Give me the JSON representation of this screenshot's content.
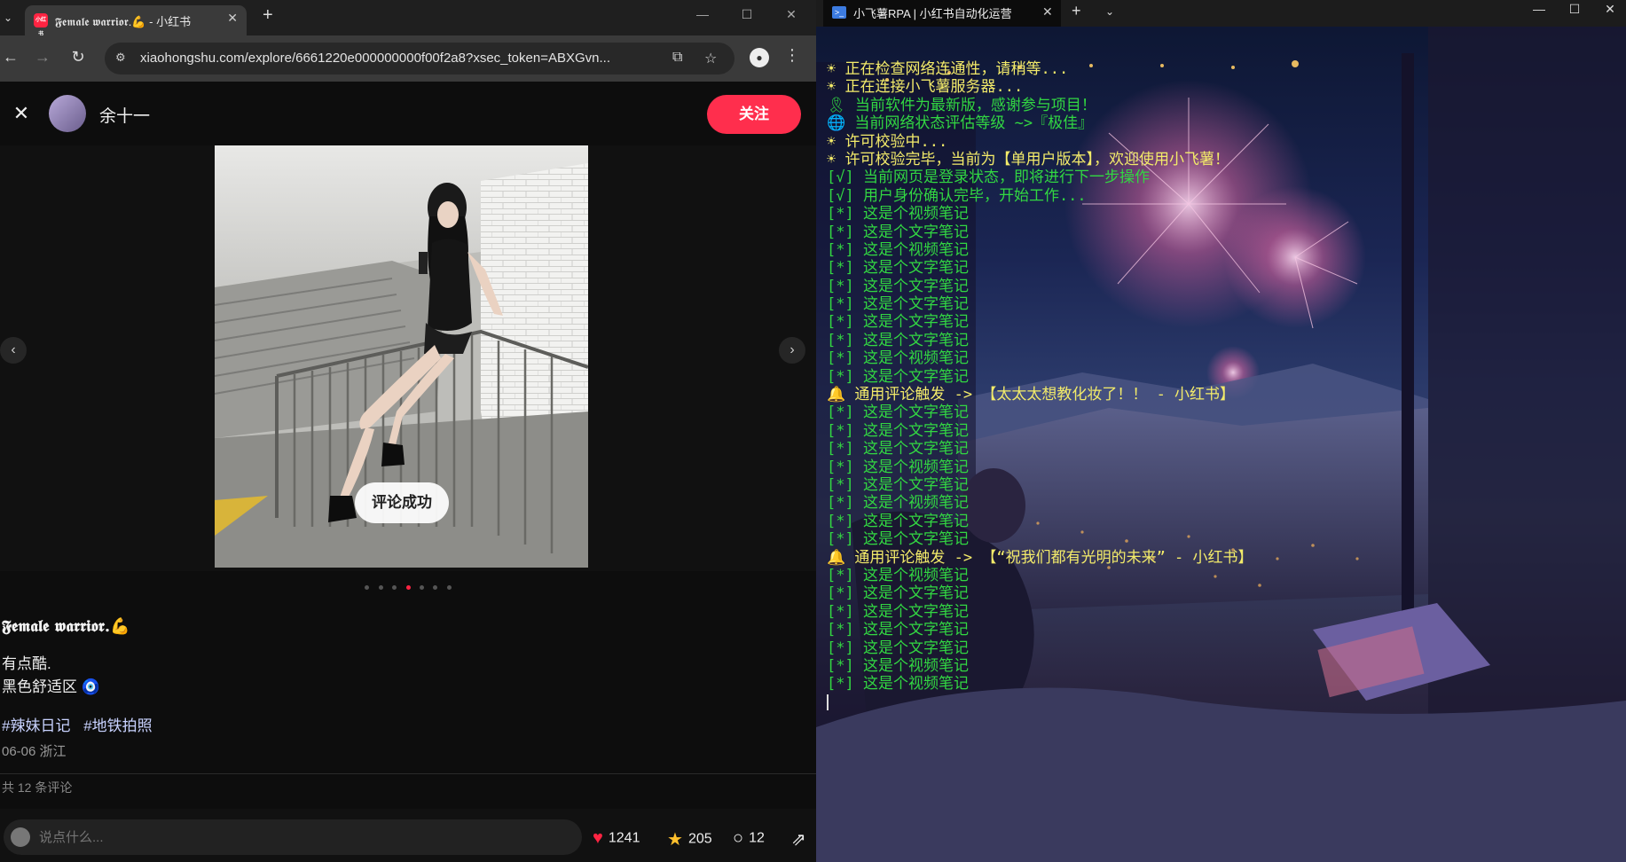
{
  "browser": {
    "tab_title": "𝕱𝖊𝖒𝖆𝖑𝖊 𝖜𝖆𝖗𝖗𝖎𝖔𝖗.💪 - 小红书",
    "url": "xiaohongshu.com/explore/6661220e000000000f00f2a8?xsec_token=ABXGvn...",
    "favicon_text": "小红书"
  },
  "note": {
    "author": "余十一",
    "follow_label": "关注",
    "toast": "评论成功",
    "title": "𝕱𝖊𝖒𝖆𝖑𝖊 𝖜𝖆𝖗𝖗𝖎𝖔𝖗.💪",
    "desc_lines": [
      "有点酷.",
      "黑色舒适区 🧿"
    ],
    "tags": [
      "#辣妹日记",
      "#地铁拍照"
    ],
    "meta": "06-06 浙江",
    "comments_total": "共 12 条评论",
    "comment_placeholder": "说点什么...",
    "likes": "1241",
    "collects": "205",
    "comments": "12",
    "carousel_current": 4,
    "carousel_total": 7
  },
  "terminal": {
    "tab_title": "小飞薯RPA | 小红书自动化运营",
    "lines": [
      {
        "icon": "☀",
        "text": "正在检查网络连通性，请稍等...",
        "color": "yellow"
      },
      {
        "icon": "☀",
        "text": "正在连接小飞薯服务器...",
        "color": "yellow"
      },
      {
        "icon": "🎗",
        "text": "当前软件为最新版，感谢参与项目！",
        "color": "green"
      },
      {
        "icon": "🌐",
        "text": "当前网络状态评估等级 ~>『极佳』",
        "color": "green"
      },
      {
        "icon": "☀",
        "text": "许可校验中...",
        "color": "yellow"
      },
      {
        "icon": "☀",
        "text": "许可校验完毕，当前为【单用户版本】，欢迎使用小飞薯！",
        "color": "yellow"
      },
      {
        "icon": "",
        "text": "[√] 当前网页是登录状态，即将进行下一步操作",
        "color": "green"
      },
      {
        "icon": "",
        "text": "[√] 用户身份确认完毕，开始工作...",
        "color": "green"
      },
      {
        "icon": "",
        "text": "[*] 这是个视频笔记",
        "color": "green"
      },
      {
        "icon": "",
        "text": "[*] 这是个文字笔记",
        "color": "green"
      },
      {
        "icon": "",
        "text": "[*] 这是个视频笔记",
        "color": "green"
      },
      {
        "icon": "",
        "text": "[*] 这是个文字笔记",
        "color": "green"
      },
      {
        "icon": "",
        "text": "[*] 这是个文字笔记",
        "color": "green"
      },
      {
        "icon": "",
        "text": "[*] 这是个文字笔记",
        "color": "green"
      },
      {
        "icon": "",
        "text": "[*] 这是个文字笔记",
        "color": "green"
      },
      {
        "icon": "",
        "text": "[*] 这是个文字笔记",
        "color": "green"
      },
      {
        "icon": "",
        "text": "[*] 这是个视频笔记",
        "color": "green"
      },
      {
        "icon": "",
        "text": "[*] 这是个文字笔记",
        "color": "green"
      },
      {
        "icon": "🔔",
        "text": "通用评论触发 -> 【太太太想教化妆了！！ - 小红书】",
        "color": "yellow"
      },
      {
        "icon": "",
        "text": "[*] 这是个文字笔记",
        "color": "green"
      },
      {
        "icon": "",
        "text": "[*] 这是个文字笔记",
        "color": "green"
      },
      {
        "icon": "",
        "text": "[*] 这是个文字笔记",
        "color": "green"
      },
      {
        "icon": "",
        "text": "[*] 这是个视频笔记",
        "color": "green"
      },
      {
        "icon": "",
        "text": "[*] 这是个文字笔记",
        "color": "green"
      },
      {
        "icon": "",
        "text": "[*] 这是个视频笔记",
        "color": "green"
      },
      {
        "icon": "",
        "text": "[*] 这是个文字笔记",
        "color": "green"
      },
      {
        "icon": "",
        "text": "[*] 这是个文字笔记",
        "color": "green"
      },
      {
        "icon": "🔔",
        "text": "通用评论触发 -> 【“祝我们都有光明的未来” - 小红书】",
        "color": "yellow"
      },
      {
        "icon": "",
        "text": "[*] 这是个视频笔记",
        "color": "green"
      },
      {
        "icon": "",
        "text": "[*] 这是个文字笔记",
        "color": "green"
      },
      {
        "icon": "",
        "text": "[*] 这是个文字笔记",
        "color": "green"
      },
      {
        "icon": "",
        "text": "[*] 这是个文字笔记",
        "color": "green"
      },
      {
        "icon": "",
        "text": "[*] 这是个文字笔记",
        "color": "green"
      },
      {
        "icon": "",
        "text": "[*] 这是个视频笔记",
        "color": "green"
      },
      {
        "icon": "",
        "text": "[*] 这是个视频笔记",
        "color": "green"
      }
    ]
  },
  "colors": {
    "accent": "#ff2442",
    "term_yellow": "#f3eb6a",
    "term_green": "#32d742"
  }
}
